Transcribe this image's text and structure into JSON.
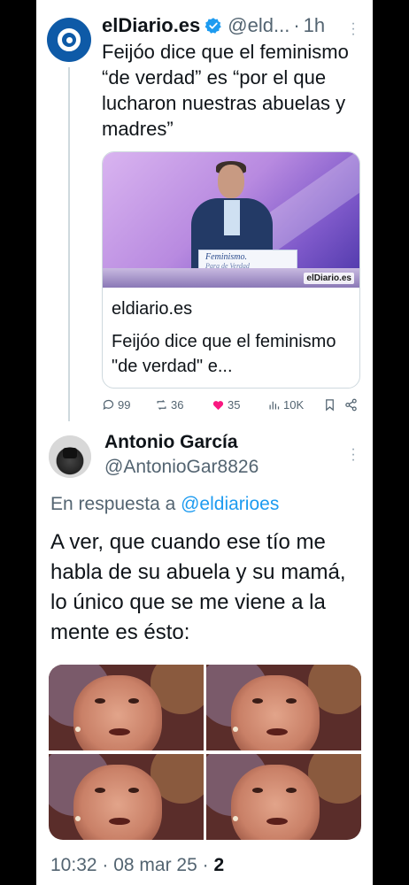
{
  "tweet1": {
    "name": "elDiario.es",
    "handle": "@eld...",
    "separator": "·",
    "time": "1h",
    "text": "Feijóo dice que el feminismo “de verdad” es “por el que lucharon nuestras abuelas y madres”",
    "card": {
      "podium_title": "Feminismo.",
      "podium_subtitle": "Para de Verdad",
      "watermark": "elDiario.es",
      "domain": "eldiario.es",
      "title": "Feijóo dice que el feminismo \"de verdad\" e..."
    },
    "actions": {
      "replies": "99",
      "reposts": "36",
      "likes": "35",
      "views": "10K"
    },
    "colors": {
      "like": "#f91880",
      "verified": "#1d9bf0",
      "avatar": "#0e5aa7"
    }
  },
  "tweet2": {
    "name": "Antonio García",
    "handle": "@AntonioGar8826",
    "reply_prefix": "En respuesta a",
    "reply_mention": "@eldiarioes",
    "text": "A ver, que cuando ese tío me habla de su abuela y su mamá, lo único que se me viene a la mente es ésto:",
    "media_count": 4,
    "footer": {
      "time": "10:32 · 08 mar 25 ·",
      "views": "2"
    },
    "colors": {
      "mention": "#1d9bf0"
    }
  }
}
